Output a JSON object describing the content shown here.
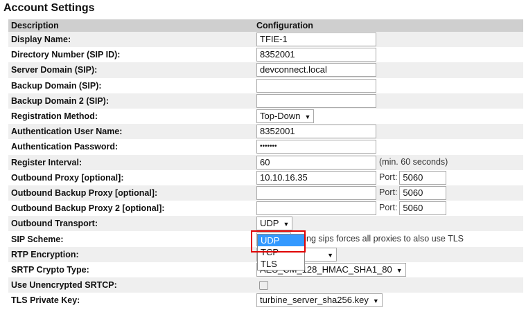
{
  "title": "Account Settings",
  "headers": {
    "description": "Description",
    "configuration": "Configuration"
  },
  "rows": {
    "display_name": {
      "label": "Display Name:",
      "value": "TFIE-1"
    },
    "directory_number": {
      "label": "Directory Number (SIP ID):",
      "value": "8352001"
    },
    "server_domain": {
      "label": "Server Domain (SIP):",
      "value": "devconnect.local"
    },
    "backup_domain": {
      "label": "Backup Domain (SIP):",
      "value": ""
    },
    "backup_domain_2": {
      "label": "Backup Domain 2 (SIP):",
      "value": ""
    },
    "registration_method": {
      "label": "Registration Method:",
      "value": "Top-Down"
    },
    "auth_user": {
      "label": "Authentication User Name:",
      "value": "8352001"
    },
    "auth_password": {
      "label": "Authentication Password:",
      "value": "•••••••"
    },
    "register_interval": {
      "label": "Register Interval:",
      "value": "60",
      "hint": "(min. 60 seconds)"
    },
    "outbound_proxy": {
      "label": "Outbound Proxy [optional]:",
      "value": "10.10.16.35",
      "port_label": "Port:",
      "port": "5060"
    },
    "outbound_backup_proxy": {
      "label": "Outbound Backup Proxy [optional]:",
      "value": "",
      "port_label": "Port:",
      "port": "5060"
    },
    "outbound_backup_proxy_2": {
      "label": "Outbound Backup Proxy 2 [optional]:",
      "value": "",
      "port_label": "Port:",
      "port": "5060"
    },
    "outbound_transport": {
      "label": "Outbound Transport:",
      "value": "UDP",
      "options": [
        "UDP",
        "TCP",
        "TLS"
      ]
    },
    "sip_scheme": {
      "label": "SIP Scheme:",
      "hint": "Using sips forces all proxies to also use TLS"
    },
    "rtp_encryption": {
      "label": "RTP Encryption:"
    },
    "srtp_crypto": {
      "label": "SRTP Crypto Type:",
      "value": "AES_CM_128_HMAC_SHA1_80"
    },
    "unencrypted_srtcp": {
      "label": "Use Unencrypted SRTCP:"
    },
    "tls_key": {
      "label": "TLS Private Key:",
      "value": "turbine_server_sha256.key"
    }
  }
}
